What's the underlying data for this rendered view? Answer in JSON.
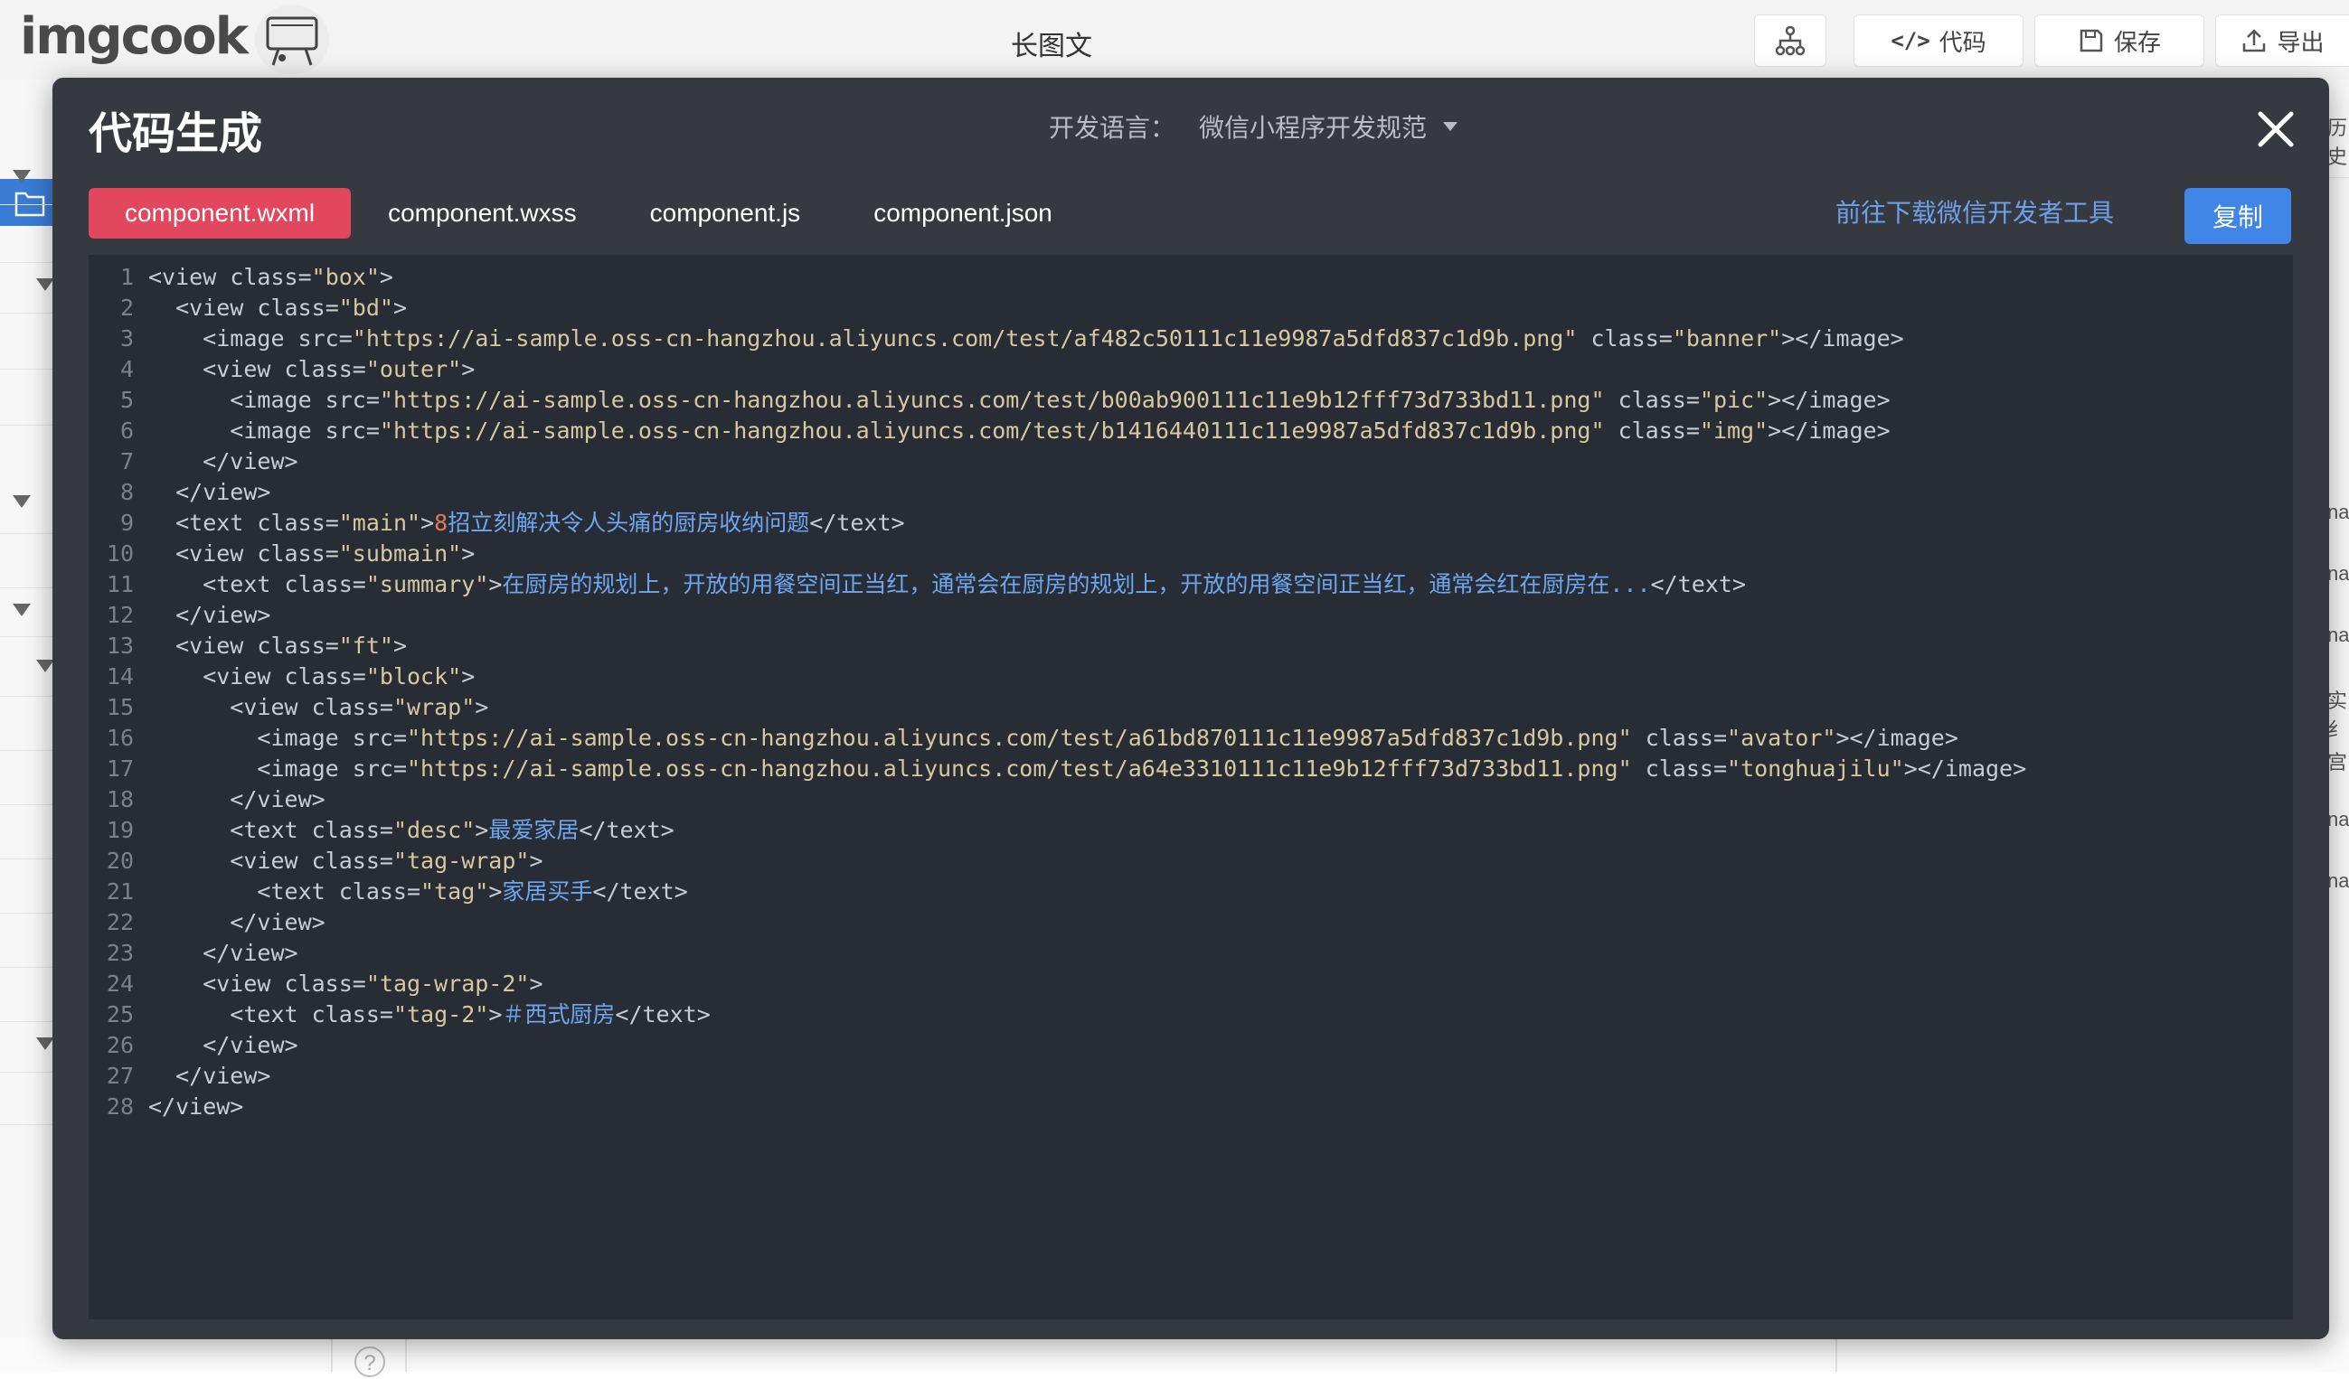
{
  "app": {
    "logo_text": "imgcook",
    "document_title": "长图文",
    "toolbar": {
      "structure_icon": "hierarchy-icon",
      "code_label": "代码",
      "save_label": "保存",
      "export_label": "导出"
    }
  },
  "modal": {
    "title": "代码生成",
    "language_label": "开发语言：",
    "language_value": "微信小程序开发规范",
    "tabs": [
      {
        "label": "component.wxml",
        "active": true
      },
      {
        "label": "component.wxss",
        "active": false
      },
      {
        "label": "component.js",
        "active": false
      },
      {
        "label": "component.json",
        "active": false
      }
    ],
    "download_link": "前往下载微信开发者工具",
    "copy_label": "复制",
    "code_lines": [
      [
        [
          "p",
          "<view "
        ],
        [
          "attr",
          "class"
        ],
        [
          "p",
          "="
        ],
        [
          "str",
          "\"box\""
        ],
        [
          "p",
          ">"
        ]
      ],
      [
        [
          "p",
          "  <view "
        ],
        [
          "attr",
          "class"
        ],
        [
          "p",
          "="
        ],
        [
          "str",
          "\"bd\""
        ],
        [
          "p",
          ">"
        ]
      ],
      [
        [
          "p",
          "    <image "
        ],
        [
          "attr",
          "src"
        ],
        [
          "p",
          "="
        ],
        [
          "str",
          "\"https://ai-sample.oss-cn-hangzhou.aliyuncs.com/test/af482c50111c11e9987a5dfd837c1d9b.png\""
        ],
        [
          "p",
          " "
        ],
        [
          "attr",
          "class"
        ],
        [
          "p",
          "="
        ],
        [
          "str",
          "\"banner\""
        ],
        [
          "p",
          "></image>"
        ]
      ],
      [
        [
          "p",
          "    <view "
        ],
        [
          "attr",
          "class"
        ],
        [
          "p",
          "="
        ],
        [
          "str",
          "\"outer\""
        ],
        [
          "p",
          ">"
        ]
      ],
      [
        [
          "p",
          "      <image "
        ],
        [
          "attr",
          "src"
        ],
        [
          "p",
          "="
        ],
        [
          "str",
          "\"https://ai-sample.oss-cn-hangzhou.aliyuncs.com/test/b00ab900111c11e9b12fff73d733bd11.png\""
        ],
        [
          "p",
          " "
        ],
        [
          "attr",
          "class"
        ],
        [
          "p",
          "="
        ],
        [
          "str",
          "\"pic\""
        ],
        [
          "p",
          "></image>"
        ]
      ],
      [
        [
          "p",
          "      <image "
        ],
        [
          "attr",
          "src"
        ],
        [
          "p",
          "="
        ],
        [
          "str",
          "\"https://ai-sample.oss-cn-hangzhou.aliyuncs.com/test/b1416440111c11e9987a5dfd837c1d9b.png\""
        ],
        [
          "p",
          " "
        ],
        [
          "attr",
          "class"
        ],
        [
          "p",
          "="
        ],
        [
          "str",
          "\"img\""
        ],
        [
          "p",
          "></image>"
        ]
      ],
      [
        [
          "p",
          "    </view>"
        ]
      ],
      [
        [
          "p",
          "  </view>"
        ]
      ],
      [
        [
          "p",
          "  <text "
        ],
        [
          "attr",
          "class"
        ],
        [
          "p",
          "="
        ],
        [
          "str",
          "\"main\""
        ],
        [
          "p",
          ">"
        ],
        [
          "num",
          "8"
        ],
        [
          "txt",
          "招立刻解决令人头痛的厨房收纳问题"
        ],
        [
          "p",
          "</text>"
        ]
      ],
      [
        [
          "p",
          "  <view "
        ],
        [
          "attr",
          "class"
        ],
        [
          "p",
          "="
        ],
        [
          "str",
          "\"submain\""
        ],
        [
          "p",
          ">"
        ]
      ],
      [
        [
          "p",
          "    <text "
        ],
        [
          "attr",
          "class"
        ],
        [
          "p",
          "="
        ],
        [
          "str",
          "\"summary\""
        ],
        [
          "p",
          ">"
        ],
        [
          "txt",
          "在厨房的规划上，开放的用餐空间正当红，通常会在厨房的规划上，开放的用餐空间正当红，通常会红在厨房在..."
        ],
        [
          "p",
          "</text>"
        ]
      ],
      [
        [
          "p",
          "  </view>"
        ]
      ],
      [
        [
          "p",
          "  <view "
        ],
        [
          "attr",
          "class"
        ],
        [
          "p",
          "="
        ],
        [
          "str",
          "\"ft\""
        ],
        [
          "p",
          ">"
        ]
      ],
      [
        [
          "p",
          "    <view "
        ],
        [
          "attr",
          "class"
        ],
        [
          "p",
          "="
        ],
        [
          "str",
          "\"block\""
        ],
        [
          "p",
          ">"
        ]
      ],
      [
        [
          "p",
          "      <view "
        ],
        [
          "attr",
          "class"
        ],
        [
          "p",
          "="
        ],
        [
          "str",
          "\"wrap\""
        ],
        [
          "p",
          ">"
        ]
      ],
      [
        [
          "p",
          "        <image "
        ],
        [
          "attr",
          "src"
        ],
        [
          "p",
          "="
        ],
        [
          "str",
          "\"https://ai-sample.oss-cn-hangzhou.aliyuncs.com/test/a61bd870111c11e9987a5dfd837c1d9b.png\""
        ],
        [
          "p",
          " "
        ],
        [
          "attr",
          "class"
        ],
        [
          "p",
          "="
        ],
        [
          "str",
          "\"avator\""
        ],
        [
          "p",
          "></image>"
        ]
      ],
      [
        [
          "p",
          "        <image "
        ],
        [
          "attr",
          "src"
        ],
        [
          "p",
          "="
        ],
        [
          "str",
          "\"https://ai-sample.oss-cn-hangzhou.aliyuncs.com/test/a64e3310111c11e9b12fff73d733bd11.png\""
        ],
        [
          "p",
          " "
        ],
        [
          "attr",
          "class"
        ],
        [
          "p",
          "="
        ],
        [
          "str",
          "\"tonghuajilu\""
        ],
        [
          "p",
          "></image>"
        ]
      ],
      [
        [
          "p",
          "      </view>"
        ]
      ],
      [
        [
          "p",
          "      <text "
        ],
        [
          "attr",
          "class"
        ],
        [
          "p",
          "="
        ],
        [
          "str",
          "\"desc\""
        ],
        [
          "p",
          ">"
        ],
        [
          "txt",
          "最爱家居"
        ],
        [
          "p",
          "</text>"
        ]
      ],
      [
        [
          "p",
          "      <view "
        ],
        [
          "attr",
          "class"
        ],
        [
          "p",
          "="
        ],
        [
          "str",
          "\"tag-wrap\""
        ],
        [
          "p",
          ">"
        ]
      ],
      [
        [
          "p",
          "        <text "
        ],
        [
          "attr",
          "class"
        ],
        [
          "p",
          "="
        ],
        [
          "str",
          "\"tag\""
        ],
        [
          "p",
          ">"
        ],
        [
          "txt",
          "家居买手"
        ],
        [
          "p",
          "</text>"
        ]
      ],
      [
        [
          "p",
          "      </view>"
        ]
      ],
      [
        [
          "p",
          "    </view>"
        ]
      ],
      [
        [
          "p",
          "    <view "
        ],
        [
          "attr",
          "class"
        ],
        [
          "p",
          "="
        ],
        [
          "str",
          "\"tag-wrap-2\""
        ],
        [
          "p",
          ">"
        ]
      ],
      [
        [
          "p",
          "      <text "
        ],
        [
          "attr",
          "class"
        ],
        [
          "p",
          "="
        ],
        [
          "str",
          "\"tag-2\""
        ],
        [
          "p",
          ">"
        ],
        [
          "txt",
          "＃西式厨房"
        ],
        [
          "p",
          "</text>"
        ]
      ],
      [
        [
          "p",
          "    </view>"
        ]
      ],
      [
        [
          "p",
          "  </view>"
        ]
      ],
      [
        [
          "p",
          "</view>"
        ]
      ]
    ]
  },
  "right_panel_fragments": [
    "历史",
    "na",
    "na",
    "na",
    "实纟",
    "宫",
    "na",
    "na"
  ],
  "colors": {
    "modal_bg": "#363a40",
    "editor_bg": "#282c34",
    "tab_active": "#e2475e",
    "copy_button": "#3f86e6",
    "link": "#6ea0ea"
  }
}
